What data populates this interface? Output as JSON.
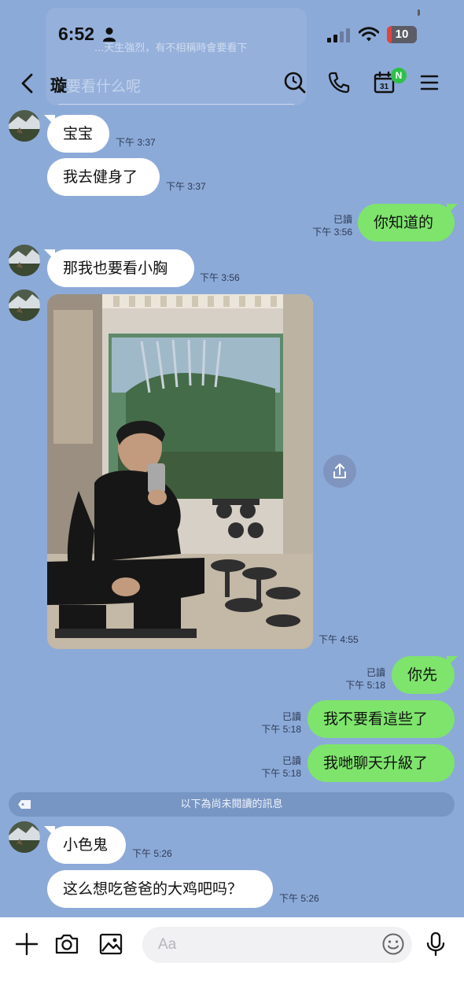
{
  "ghost": {
    "notice_text": "...天生強烈，有不相稱時會要看下",
    "search_placeholder": "要看什么呢"
  },
  "status_bar": {
    "time": "6:52",
    "battery_level": "10",
    "icons": [
      "person-icon",
      "signal-icon",
      "wifi-icon",
      "battery-icon"
    ]
  },
  "nav": {
    "title": "璇",
    "calendar_day": "31",
    "calendar_badge": "N",
    "icons": [
      "back-chevron-icon",
      "search-icon",
      "phone-icon",
      "calendar-icon",
      "menu-icon"
    ]
  },
  "messages": [
    {
      "side": "in",
      "text": "宝宝",
      "time": "下午 3:37"
    },
    {
      "side": "in",
      "text": "我去健身了",
      "time": "下午 3:37"
    },
    {
      "side": "out",
      "text": "你知道的",
      "time": "下午 3:56",
      "read": "已讀"
    },
    {
      "side": "in",
      "text": "那我也要看小胸",
      "time": "下午 3:56"
    },
    {
      "side": "in",
      "type": "photo",
      "time": "下午 4:55"
    },
    {
      "side": "out",
      "text": "你先",
      "time": "下午 5:18",
      "read": "已讀"
    },
    {
      "side": "out",
      "text": "我不要看這些了",
      "time": "下午 5:18",
      "read": "已讀"
    },
    {
      "side": "out",
      "text": "我哋聊天升級了",
      "time": "下午 5:18",
      "read": "已讀"
    },
    {
      "side": "in",
      "text": "小色鬼",
      "time": "下午 5:26"
    },
    {
      "side": "in",
      "text": "这么想吃爸爸的大鸡吧吗？",
      "time": "下午 5:26"
    }
  ],
  "unread_divider": "以下為尚未閱讀的訊息",
  "input_bar": {
    "placeholder": "Aa",
    "icons": [
      "plus-icon",
      "camera-icon",
      "image-icon",
      "emoji-icon",
      "microphone-icon"
    ]
  },
  "colors": {
    "background": "#8caad8",
    "incoming_bubble": "#ffffff",
    "outgoing_bubble": "#7ee46c",
    "unread_bar": "#7896c4",
    "badge": "#2ec14a"
  }
}
